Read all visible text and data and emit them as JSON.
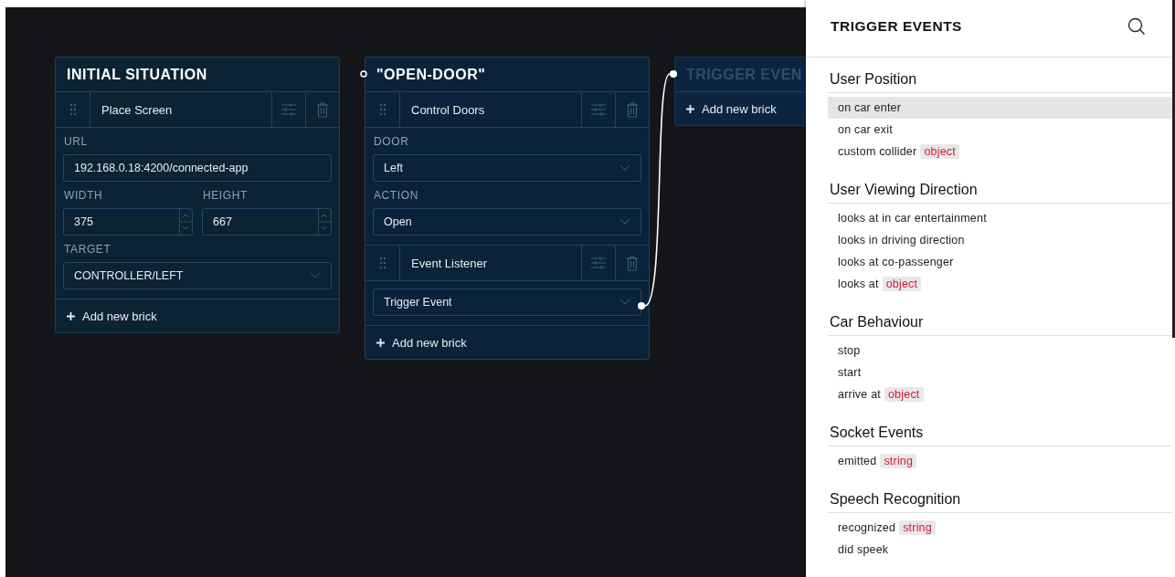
{
  "nodes": [
    {
      "title": "INITIAL SITUATION",
      "faded": false,
      "bricks": [
        {
          "name": "Place Screen",
          "rows": [
            [
              {
                "kind": "text",
                "label": "URL",
                "value": "192.168.0.18:4200/connected-app"
              }
            ],
            [
              {
                "kind": "number",
                "label": "WIDTH",
                "value": "375"
              },
              {
                "kind": "number",
                "label": "HEIGHT",
                "value": "667"
              }
            ],
            [
              {
                "kind": "select",
                "label": "TARGET",
                "value": "CONTROLLER/LEFT"
              }
            ]
          ]
        }
      ],
      "add_button": "Add new brick"
    },
    {
      "title": "\"OPEN-DOOR\"",
      "faded": false,
      "bricks": [
        {
          "name": "Control Doors",
          "rows": [
            [
              {
                "kind": "select",
                "label": "DOOR",
                "value": "Left"
              }
            ],
            [
              {
                "kind": "select",
                "label": "ACTION",
                "value": "Open"
              }
            ]
          ]
        },
        {
          "name": "Event Listener",
          "rows": [
            [
              {
                "kind": "select",
                "value": "Trigger Event"
              }
            ]
          ]
        }
      ],
      "add_button": "Add new brick"
    },
    {
      "title": "TRIGGER EVEN",
      "faded": true,
      "add_button": "Add new brick"
    }
  ],
  "panel": {
    "title": "TRIGGER EVENTS",
    "sections": [
      {
        "heading": "User Position",
        "items": [
          {
            "text": "on car enter",
            "selected": true
          },
          {
            "text": "on car exit",
            "selected": false
          },
          {
            "text": "custom collider",
            "param": "object",
            "selected": false
          }
        ]
      },
      {
        "heading": "User Viewing Direction",
        "items": [
          {
            "text": "looks at in car entertainment",
            "selected": false
          },
          {
            "text": "looks in driving direction",
            "selected": false
          },
          {
            "text": "looks at co-passenger",
            "selected": false
          },
          {
            "text": "looks at",
            "param": "object",
            "selected": false
          }
        ]
      },
      {
        "heading": "Car Behaviour",
        "items": [
          {
            "text": "stop",
            "selected": false
          },
          {
            "text": "start",
            "selected": false
          },
          {
            "text": "arrive at",
            "param": "object",
            "selected": false
          }
        ]
      },
      {
        "heading": "Socket Events",
        "items": [
          {
            "text": "emitted",
            "param": "string",
            "selected": false
          }
        ]
      },
      {
        "heading": "Speech Recognition",
        "items": [
          {
            "text": "recognized",
            "param": "string",
            "selected": false
          },
          {
            "text": "did speek",
            "selected": false
          }
        ]
      }
    ]
  }
}
